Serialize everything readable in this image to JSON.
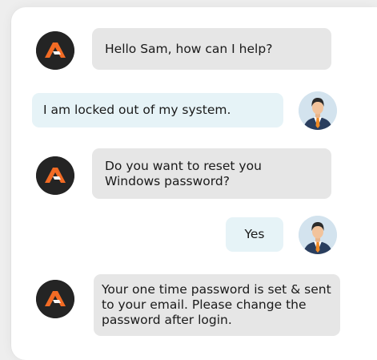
{
  "chat": {
    "messages": [
      {
        "sender": "bot",
        "text": "Hello Sam, how can I help?"
      },
      {
        "sender": "user",
        "text": "I am locked out of my system."
      },
      {
        "sender": "bot",
        "text": "Do you want to reset you Windows password?"
      },
      {
        "sender": "user",
        "text": "Yes"
      },
      {
        "sender": "bot",
        "text": "Your one time password is set & sent to your email. Please change the password after login."
      }
    ]
  },
  "icons": {
    "bot": "bot-logo-icon",
    "user": "user-avatar-icon"
  },
  "colors": {
    "bot_avatar_bg": "#242424",
    "bot_logo_accent": "#f26b24",
    "bot_bubble_bg": "#e6e6e6",
    "user_bubble_bg": "#e6f3f7",
    "user_avatar_bg": "#d3e3ee",
    "suit": "#2a3e5e",
    "tie": "#f08a24"
  }
}
